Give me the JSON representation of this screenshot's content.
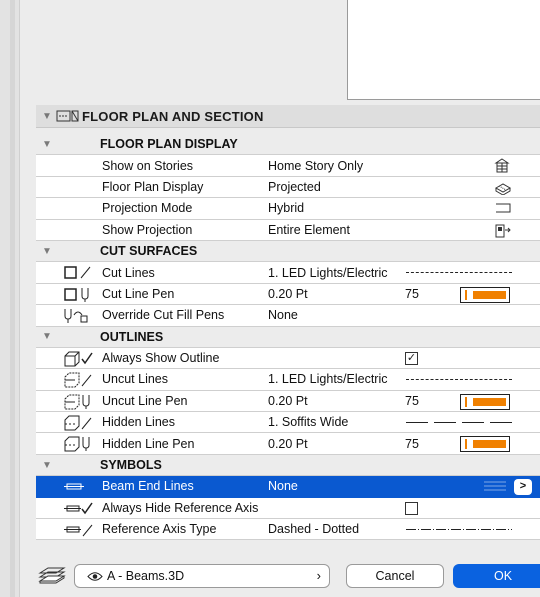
{
  "section": {
    "title": "FLOOR PLAN AND SECTION"
  },
  "groups": {
    "display": "FLOOR PLAN DISPLAY",
    "cut": "CUT SURFACES",
    "outlines": "OUTLINES",
    "symbols": "SYMBOLS"
  },
  "rows": {
    "show_on_stories": {
      "label": "Show on Stories",
      "value": "Home Story Only"
    },
    "floor_plan_display": {
      "label": "Floor Plan Display",
      "value": "Projected"
    },
    "projection_mode": {
      "label": "Projection Mode",
      "value": "Hybrid"
    },
    "show_projection": {
      "label": "Show Projection",
      "value": "Entire Element"
    },
    "cut_lines": {
      "label": "Cut Lines",
      "value": "1. LED Lights/Electric"
    },
    "cut_line_pen": {
      "label": "Cut Line Pen",
      "value": "0.20 Pt",
      "pen": "75"
    },
    "override_cut_fill": {
      "label": "Override Cut Fill Pens",
      "value": "None"
    },
    "always_show_outline": {
      "label": "Always Show Outline",
      "checked": true
    },
    "uncut_lines": {
      "label": "Uncut Lines",
      "value": "1. LED Lights/Electric"
    },
    "uncut_line_pen": {
      "label": "Uncut Line Pen",
      "value": "0.20 Pt",
      "pen": "75"
    },
    "hidden_lines": {
      "label": "Hidden Lines",
      "value": "1. Soffits Wide"
    },
    "hidden_line_pen": {
      "label": "Hidden Line Pen",
      "value": "0.20 Pt",
      "pen": "75"
    },
    "beam_end_lines": {
      "label": "Beam End Lines",
      "value": "None"
    },
    "always_hide_axis": {
      "label": "Always Hide Reference Axis",
      "checked": false
    },
    "reference_axis_type": {
      "label": "Reference Axis Type",
      "value": "Dashed - Dotted"
    }
  },
  "footer": {
    "favorites": "A - Beams.3D",
    "cancel": "Cancel",
    "ok": "OK"
  },
  "colors": {
    "selection": "#0a59d0",
    "pen_orange": "#f08000",
    "ok_blue": "#0a62e0"
  }
}
